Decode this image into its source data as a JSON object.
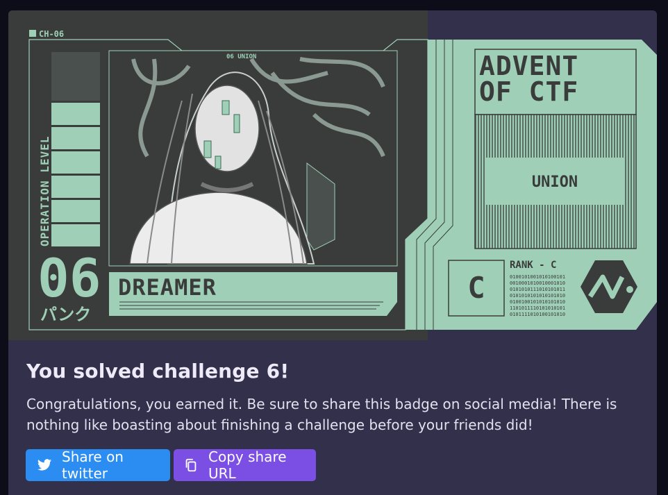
{
  "badge": {
    "channel": "CH-06",
    "union_top": "06 UNION",
    "side_label": "OPERATION LEVEL",
    "number": "06",
    "katakana": "パンク",
    "name": "DREAMER",
    "event_line1": "ADVENT",
    "event_line2": "OF CTF",
    "union": "UNION",
    "rank": "RANK - C",
    "rank_letter": "C",
    "binary": [
      "0100101001010100101",
      "0010001010010001010",
      "0101010111010101011",
      "0101010101010101010",
      "0100100101010101010",
      "1101011110101010101",
      "0101111010100101010"
    ],
    "colors": {
      "mint": "#9fd0b7",
      "dark": "#3a3c3c",
      "card": "#32304a"
    }
  },
  "content": {
    "title": "You solved challenge 6!",
    "message": "Congratulations, you earned it. Be sure to share this badge on social media! There is nothing like boasting about finishing a challenge before your friends did!"
  },
  "actions": {
    "twitter_label": "Share on twitter",
    "twitter_icon": "twitter-icon",
    "copy_label": "Copy share URL",
    "copy_icon": "copy-icon",
    "twitter_color": "#2b8df2",
    "copy_color": "#7b4fe3"
  }
}
